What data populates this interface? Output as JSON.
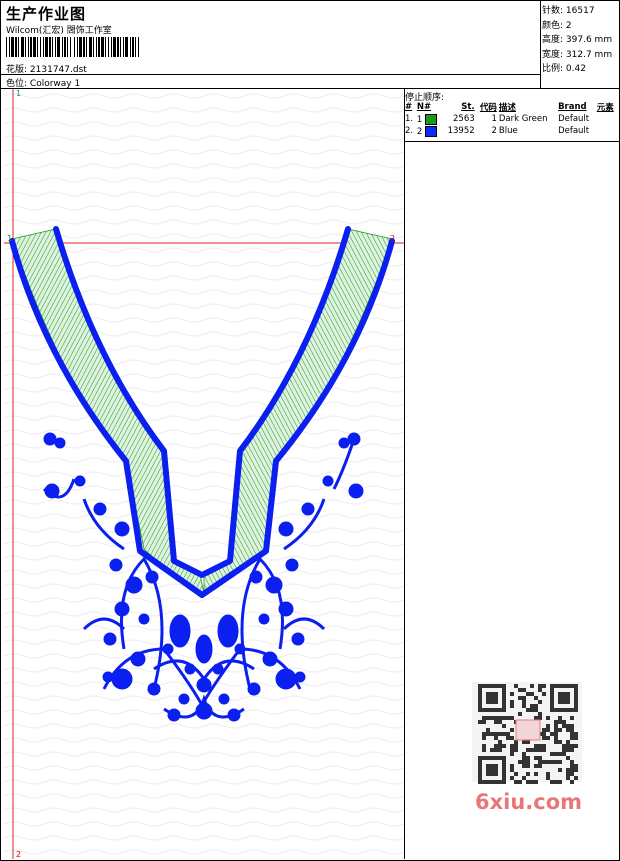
{
  "header": {
    "title": "生产作业图",
    "company": "Wilcom(汇宏) 䦓饰工作室",
    "design_label": "花版:",
    "design_value": "2131747.dst",
    "colorway_label": "色位:",
    "colorway_value": "Colorway 1"
  },
  "stats": {
    "stitches_label": "针数:",
    "stitches_value": "16517",
    "colors_label": "颜色:",
    "colors_value": "2",
    "height_label": "高度:",
    "height_value": "397.6 mm",
    "width_label": "宽度:",
    "width_value": "312.7 mm",
    "scale_label": "比例:",
    "scale_value": "0.42"
  },
  "stop_sequence": {
    "title": "停止顺序:",
    "columns": [
      "#",
      "N#",
      "St.",
      "代码",
      "描述",
      "Brand",
      "元素"
    ],
    "rows": [
      {
        "num": "1.",
        "n": "1",
        "stitches": "2563",
        "code": "1",
        "desc": "Dark Green",
        "brand": "Default",
        "color": "#1a9a1a"
      },
      {
        "num": "2.",
        "n": "2",
        "stitches": "13952",
        "code": "2",
        "desc": "Blue",
        "brand": "Default",
        "color": "#0a2bff"
      }
    ]
  },
  "markers": {
    "top_left": "1",
    "bottom_left": "2",
    "left_cross": "1",
    "right_cross": "2"
  },
  "watermark": {
    "site": "6xiu.com"
  },
  "colors": {
    "green": "#1a9a1a",
    "blue": "#0a1ff0",
    "guide_red": "#e02020"
  }
}
